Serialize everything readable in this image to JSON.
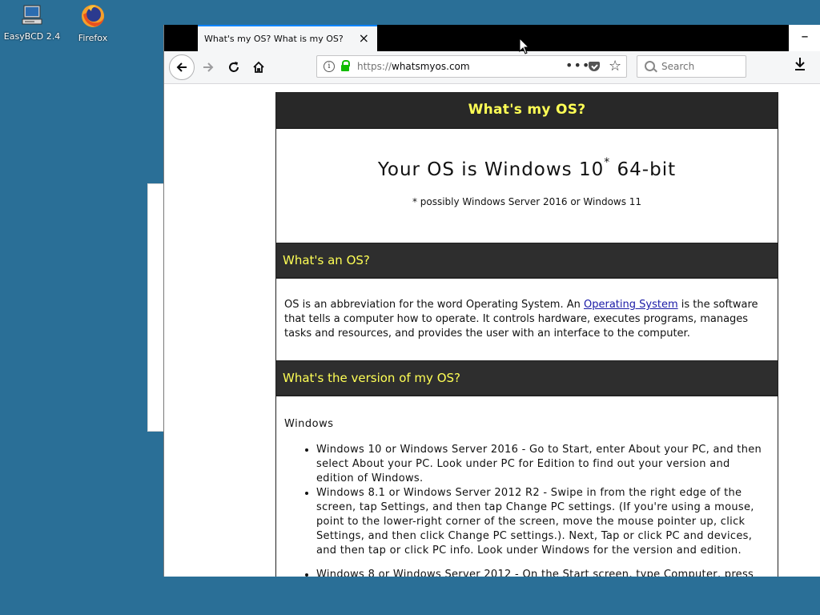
{
  "desktop": {
    "icons": [
      {
        "label": "EasyBCD 2.4"
      },
      {
        "label": "Firefox"
      }
    ]
  },
  "browser": {
    "tab_title": "What's my OS? What is my OS?",
    "tab_close": "×",
    "minimize": "–",
    "url_dim": "https://",
    "url_host": "whatsmyos.com",
    "url_more": "•••",
    "search_placeholder": "Search"
  },
  "page": {
    "site_title": "What's my OS?",
    "os_result_prefix": "Your OS is Windows 10",
    "os_result_mark": "*",
    "os_result_suffix": " 64-bit",
    "os_note": "* possibly Windows Server 2016 or Windows 11",
    "section1_title": "What's an OS?",
    "section1_text_a": "OS is an abbreviation for the word Operating System. An ",
    "section1_link": "Operating System",
    "section1_text_b": " is the software that tells a computer how to operate. It controls hardware, executes programs, manages tasks and resources, and provides the user with an interface to the computer.",
    "section2_title": "What's the version of my OS?",
    "windows_heading": "Windows",
    "windows_items": [
      "Windows 10 or Windows Server 2016 - Go to Start, enter About your PC, and then select About your PC. Look under PC for Edition to find out your version and edition of Windows.",
      "Windows 8.1 or Windows Server 2012 R2 - Swipe in from the right edge of the screen, tap Settings, and then tap Change PC settings. (If you're using a mouse, point to the lower-right corner of the screen, move the mouse pointer up, click Settings, and then click Change PC settings.). Next, Tap or click PC and devices, and then tap or click PC info. Look under Windows for the version and edition.",
      "Windows 8 or Windows Server 2012 - On the Start screen, type Computer, press"
    ]
  }
}
